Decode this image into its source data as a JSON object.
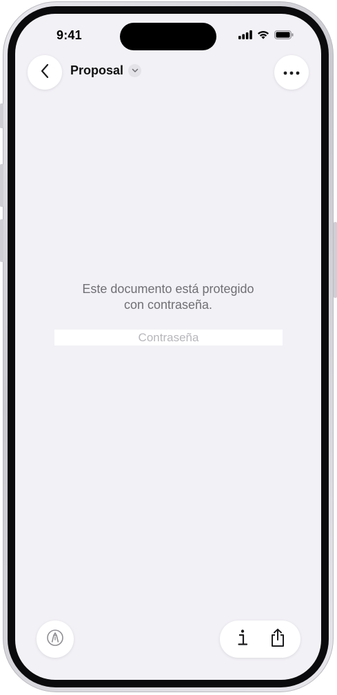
{
  "status_bar": {
    "time": "9:41",
    "icons": [
      "cellular-signal-icon",
      "wifi-icon",
      "battery-icon"
    ]
  },
  "nav_bar": {
    "back_icon": "chevron-left-icon",
    "title": "Proposal",
    "title_menu_icon": "chevron-down-icon",
    "more_icon": "ellipsis-icon"
  },
  "document": {
    "message_line_1": "Este documento está protegido",
    "message_line_2": "con contraseña.",
    "password_placeholder": "Contraseña",
    "password_value": ""
  },
  "toolbar": {
    "markup_icon": "markup-pen-icon",
    "info_icon": "info-icon",
    "share_icon": "share-icon"
  },
  "colors": {
    "screen_background": "#f2f1f6",
    "message_text": "#6f6f74",
    "placeholder_text": "#b7b7bc"
  }
}
